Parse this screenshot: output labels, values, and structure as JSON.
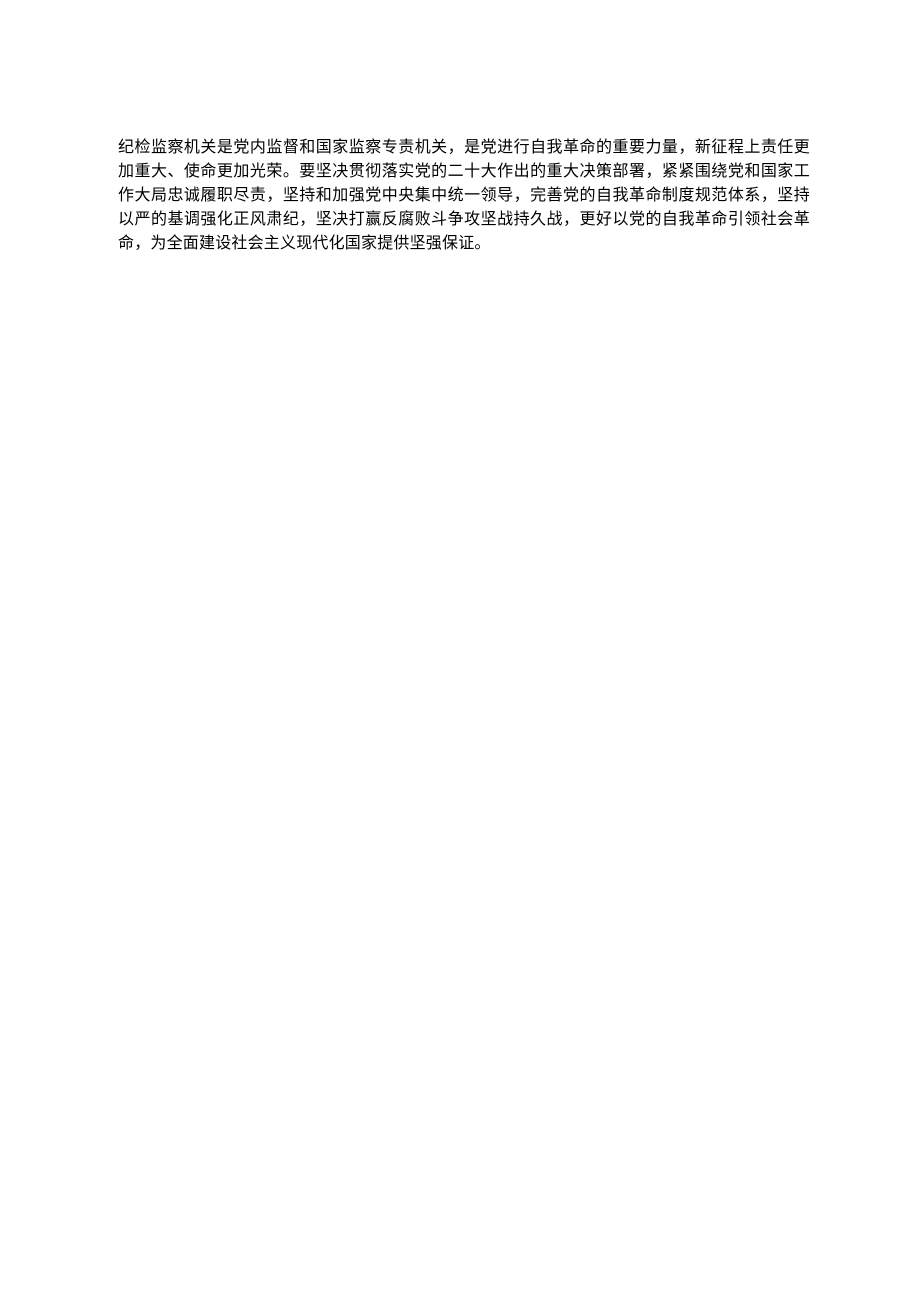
{
  "document": {
    "paragraph": "纪检监察机关是党内监督和国家监察专责机关，是党进行自我革命的重要力量，新征程上责任更加重大、使命更加光荣。要坚决贯彻落实党的二十大作出的重大决策部署，紧紧围绕党和国家工作大局忠诚履职尽责，坚持和加强党中央集中统一领导，完善党的自我革命制度规范体系，坚持以严的基调强化正风肃纪，坚决打赢反腐败斗争攻坚战持久战，更好以党的自我革命引领社会革命，为全面建设社会主义现代化国家提供坚强保证。"
  }
}
